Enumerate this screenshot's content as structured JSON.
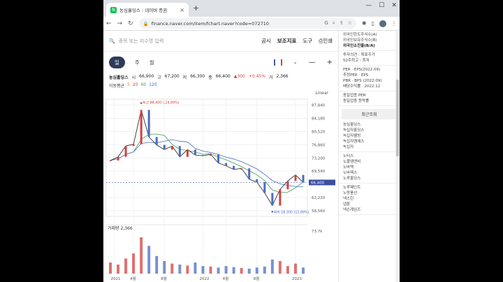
{
  "browser": {
    "tab_title": "농심홀딩스 : 네이버 증권",
    "favicon": "N",
    "tab_close": "×",
    "new_tab": "+",
    "url": "finance.naver.com/item/fchart.naver?code=072710",
    "window_controls": [
      "—",
      "☐",
      "✕"
    ]
  },
  "page": {
    "search_placeholder": "종목 또는 지수명 입력",
    "menu": [
      "공시",
      "보조지표",
      "도구",
      "인쇄"
    ],
    "periods": [
      "일",
      "주",
      "월"
    ],
    "active_period": "일",
    "stock_name": "농심홀딩스",
    "quote": {
      "open_label": "시",
      "open": "66,900",
      "high_label": "고",
      "high": "67,200",
      "low_label": "저",
      "low": "66,300",
      "close_label": "종",
      "close": "66,400",
      "change": "▲300",
      "change_pct": "+0.45%",
      "vol_label": "거",
      "volume": "2,366"
    },
    "ma_label": "이동평균",
    "ma": [
      "5",
      "20",
      "60",
      "120"
    ],
    "scale_mode": "Linear",
    "y_ticks": [
      "87,840",
      "84,180",
      "80,520",
      "76,860",
      "73,200",
      "69,540",
      "66,400",
      "62,220",
      "58,560"
    ],
    "x_ticks": [
      "2021",
      "4월",
      "8월",
      "2022",
      "4월",
      "8월",
      "2023"
    ],
    "max_label": "최고 88,400 (-24.89%)",
    "min_label": "최저 58,300 (13.89%)",
    "current_price_tag": "66,400",
    "volume_label": "거래량 2,366",
    "volume_tick": "73.7k",
    "colors": {
      "up": "#d1423f",
      "down": "#4b6cc2",
      "ma5": "#e88b39",
      "ma20": "#d1423f",
      "ma60": "#3aa055",
      "ma120": "#4b6cc2",
      "accent": "#2f3b5c"
    }
  },
  "chart_data": {
    "type": "candlestick",
    "x": [
      "2021-01",
      "2021-02",
      "2021-03",
      "2021-04",
      "2021-05",
      "2021-06",
      "2021-07",
      "2021-08",
      "2021-09",
      "2021-10",
      "2021-11",
      "2021-12",
      "2022-01",
      "2022-02",
      "2022-03",
      "2022-04",
      "2022-05",
      "2022-06",
      "2022-07",
      "2022-08",
      "2022-09",
      "2022-10",
      "2022-11",
      "2022-12",
      "2023-01",
      "2023-02"
    ],
    "close": [
      72500,
      73500,
      76500,
      77000,
      86500,
      79000,
      76800,
      75500,
      76500,
      73500,
      75500,
      74000,
      73800,
      74200,
      71800,
      71000,
      70000,
      70300,
      67300,
      66500,
      63500,
      60000,
      64500,
      66800,
      68500,
      66400
    ],
    "ylim": [
      57000,
      89500
    ],
    "max": 88400,
    "min": 58300,
    "volume": [
      22,
      18,
      30,
      40,
      72,
      55,
      35,
      25,
      20,
      18,
      16,
      22,
      15,
      14,
      12,
      15,
      13,
      11,
      10,
      12,
      14,
      28,
      25,
      15,
      20,
      12
    ]
  },
  "right": {
    "info_lines": [
      "외국인한도주식수(A)",
      "외국인보유주식수(B)",
      "외국인소진율(B/A)"
    ],
    "opinion_lines": [
      "투자의견 : 목표주가",
      "52주최고 : 최저"
    ],
    "per_lines": [
      "PER · EPS(2022.09)",
      "추정PER · EPS",
      "PBR · BPS (2022.09)",
      "배당수익률 · 2022.12"
    ],
    "industry_lines": [
      "동일업종 PER",
      "동일업종 등락률"
    ],
    "recent_title": "최근조회",
    "recent_group1": [
      "농심홀딩스",
      "녹십자홀딩스",
      "녹십자웰빙",
      "녹십자엠에스",
      "녹십자"
    ],
    "recent_group2": [
      "노터스",
      "노블엠앤비",
      "노바텍",
      "노바렉스",
      "노루홀딩스"
    ],
    "recent_group3": [
      "노루페인트",
      "노랑풍선",
      "넥스틴",
      "넵튠",
      "넥슨게임즈"
    ]
  }
}
